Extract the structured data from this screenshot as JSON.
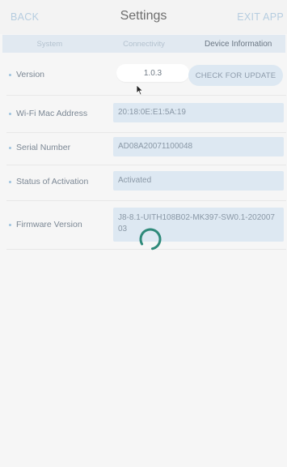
{
  "header": {
    "back_label": "BACK",
    "title": "Settings",
    "exit_label": "EXIT APP"
  },
  "tabs": [
    {
      "label": "System",
      "active": false
    },
    {
      "label": "Connectivity",
      "active": false
    },
    {
      "label": "Device Information",
      "active": true
    }
  ],
  "rows": {
    "version": {
      "label": "Version",
      "value": "1.0.3",
      "button_label": "CHECK FOR UPDATE"
    },
    "wifi_mac": {
      "label": "Wi-Fi Mac Address",
      "value": "20:18:0E:E1:5A:19"
    },
    "serial": {
      "label": "Serial Number",
      "value": "AD08A20071100048"
    },
    "activation": {
      "label": "Status of Activation",
      "value": "Activated"
    },
    "firmware": {
      "label": "Firmware Version",
      "value": "J8-8.1-UITH108B02-MK397-SW0.1-20200703"
    }
  },
  "colors": {
    "accent": "#2f8a7a",
    "field_bg": "#dde8f2",
    "tab_bar_bg": "#e1e9f1",
    "link": "#b6cde0"
  },
  "icons": {
    "spinner": "loading-spinner-icon",
    "cursor": "mouse-pointer-icon"
  }
}
